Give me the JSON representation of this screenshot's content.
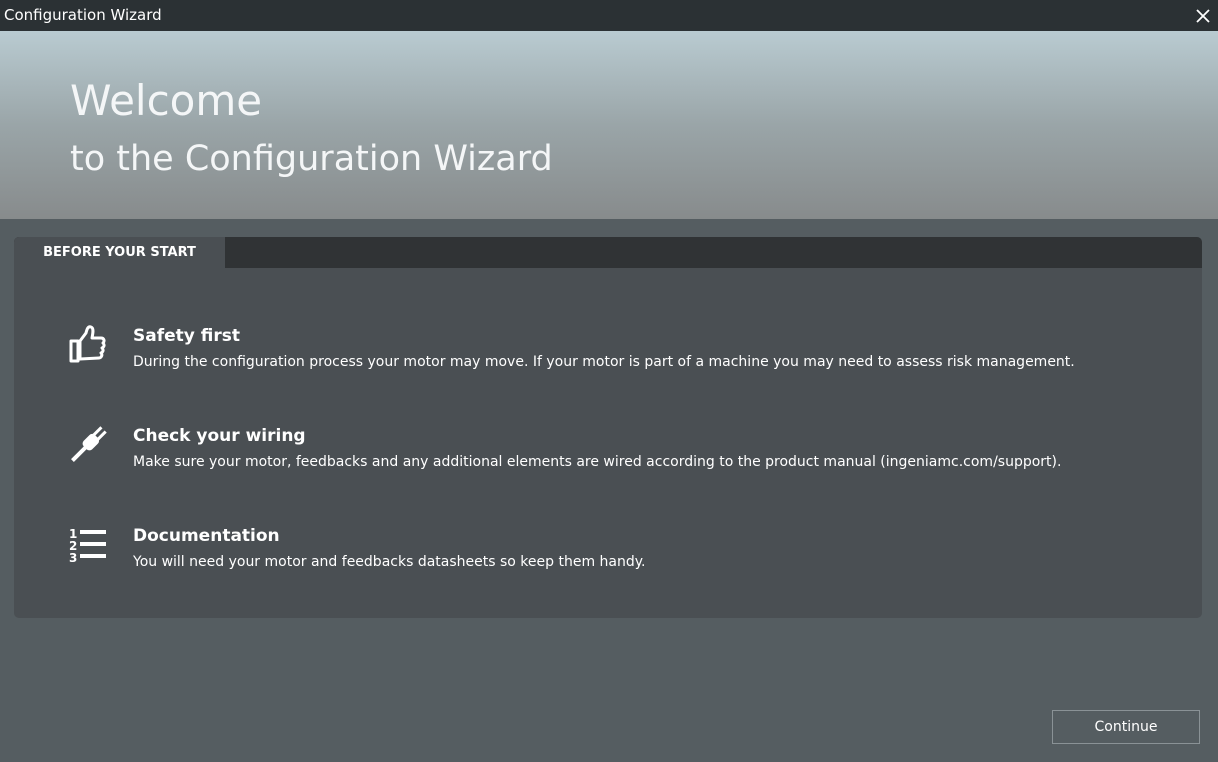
{
  "window": {
    "title": "Configuration Wizard",
    "close_icon": "close-icon"
  },
  "hero": {
    "line1": "Welcome",
    "line2": "to the Configuration Wizard"
  },
  "panel": {
    "tab_label": "BEFORE YOUR START",
    "items": [
      {
        "icon": "thumbs-up-icon",
        "heading": "Safety first",
        "description": "During the configuration process your motor may move. If your motor is part of a machine you may need to assess risk management."
      },
      {
        "icon": "plug-icon",
        "heading": "Check your wiring",
        "description": "Make sure your motor, feedbacks and any additional elements are wired according to the product manual (ingeniamc.com/support)."
      },
      {
        "icon": "numbered-list-icon",
        "heading": "Documentation",
        "description": "You will need your motor and feedbacks datasheets so keep them handy."
      }
    ]
  },
  "footer": {
    "continue_label": "Continue"
  },
  "colors": {
    "titlebar": "#2b3134",
    "background": "#555d61",
    "panel": "#4a4f53",
    "panel_header": "#303335"
  }
}
